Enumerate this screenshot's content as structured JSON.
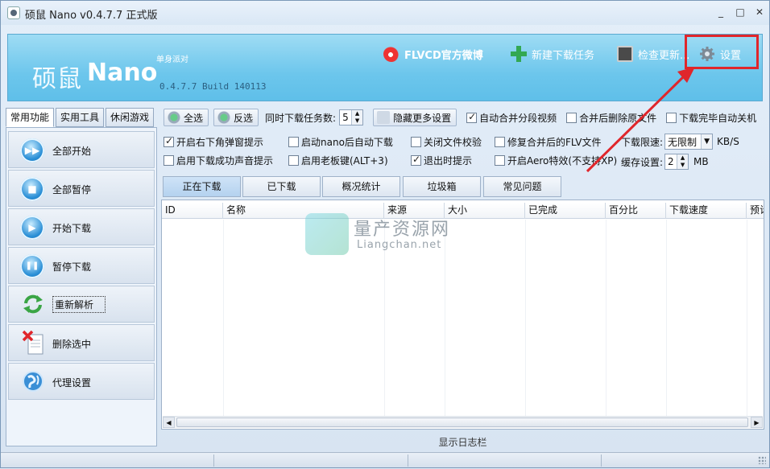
{
  "window": {
    "title": "硕鼠 Nano v0.4.7.7 正式版",
    "controls": {
      "minimize": "_",
      "maximize": "□",
      "close": "✕"
    }
  },
  "banner": {
    "logo_cn": "硕鼠",
    "logo_en": "Nano",
    "tagline": "单身派对",
    "build": "0.4.7.7 Build 140113",
    "links": {
      "weibo": "FLVCD官方微博",
      "new_task": "新建下载任务",
      "check_update": "检查更新...",
      "settings": "设置"
    }
  },
  "left_tabs": [
    "常用功能",
    "实用工具",
    "休闲游戏"
  ],
  "left_buttons": [
    {
      "label": "全部开始",
      "icon": "fast-forward-icon",
      "glyph": "▶▶"
    },
    {
      "label": "全部暂停",
      "icon": "stop-icon",
      "glyph": "■"
    },
    {
      "label": "开始下载",
      "icon": "play-icon",
      "glyph": "▶"
    },
    {
      "label": "暂停下载",
      "icon": "pause-icon",
      "glyph": "❚❚"
    },
    {
      "label": "重新解析",
      "icon": "refresh-icon"
    },
    {
      "label": "删除选中",
      "icon": "delete-icon"
    },
    {
      "label": "代理设置",
      "icon": "globe-icon"
    }
  ],
  "toolbar": {
    "select_all": "全选",
    "invert": "反选",
    "concurrent_label": "同时下载任务数:",
    "concurrent_value": "5",
    "hide_more": "隐藏更多设置",
    "auto_merge": {
      "label": "自动合并分段视频",
      "checked": true
    },
    "delete_after_merge": {
      "label": "合并后删除原文件",
      "checked": false
    },
    "shutdown_after": {
      "label": "下载完毕自动关机",
      "checked": false
    }
  },
  "options": {
    "popup_notice": {
      "label": "开启右下角弹窗提示",
      "checked": true
    },
    "auto_download": {
      "label": "启动nano后自动下载",
      "checked": false
    },
    "disable_verify": {
      "label": "关闭文件校验",
      "checked": false
    },
    "repair_flv": {
      "label": "修复合并后的FLV文件",
      "checked": false
    },
    "success_sound": {
      "label": "启用下载成功声音提示",
      "checked": false
    },
    "boss_key": {
      "label": "启用老板键(ALT+3)",
      "checked": false
    },
    "exit_prompt": {
      "label": "退出时提示",
      "checked": true
    },
    "aero": {
      "label": "开启Aero特效(不支持XP)",
      "checked": false
    },
    "speed_limit_label": "下载限速:",
    "speed_limit_value": "无限制",
    "speed_unit": "KB/S",
    "cache_label": "缓存设置:",
    "cache_value": "2",
    "cache_unit": "MB"
  },
  "tabs": [
    "正在下载",
    "已下载",
    "概况统计",
    "垃圾箱",
    "常见问题"
  ],
  "table": {
    "columns": [
      "ID",
      "名称",
      "来源",
      "大小",
      "已完成",
      "百分比",
      "下载速度",
      "预计"
    ]
  },
  "watermark": {
    "cn": "量产资源网",
    "en": "Liangchan.net"
  },
  "log_bar": "显示日志栏",
  "colors": {
    "accent": "#6cc6ec",
    "highlight": "#e0262b"
  }
}
